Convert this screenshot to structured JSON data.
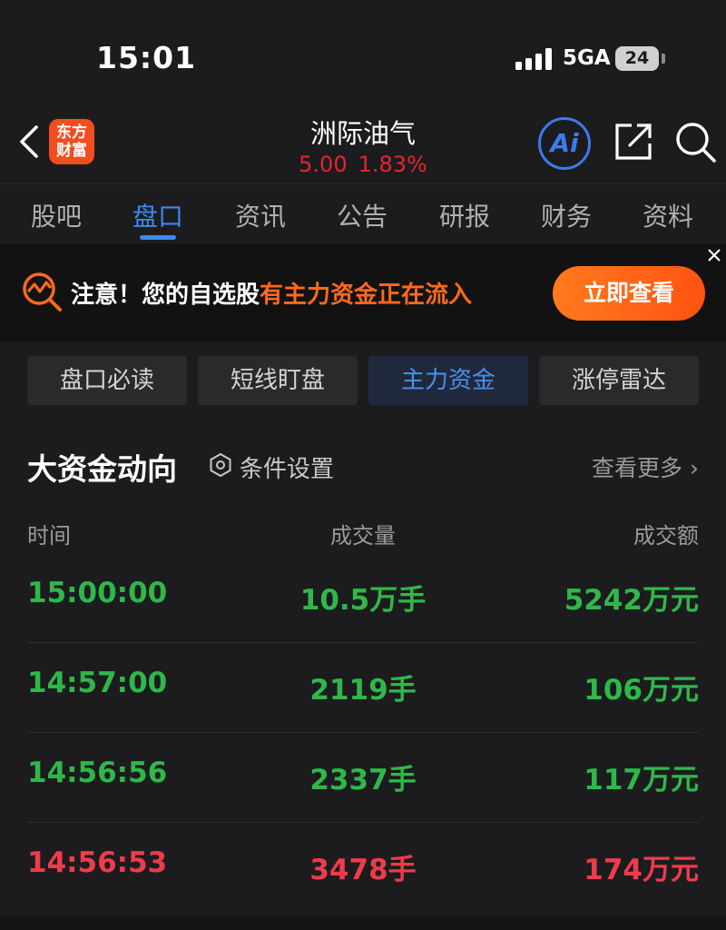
{
  "status_bar": {
    "time": "15:01",
    "network": "5GA",
    "battery": "24"
  },
  "header": {
    "logo_line1": "东方",
    "logo_line2": "财富",
    "stock_name": "洲际油气",
    "price": "5.00",
    "change_pct": "1.83%",
    "ai_label": "Ai",
    "icons": [
      "back-icon",
      "ai-icon",
      "share-icon",
      "search-icon"
    ]
  },
  "tabs": [
    {
      "label": "股吧"
    },
    {
      "label": "盘口",
      "active": true
    },
    {
      "label": "资讯"
    },
    {
      "label": "公告"
    },
    {
      "label": "研报"
    },
    {
      "label": "财务"
    },
    {
      "label": "资料"
    }
  ],
  "banner": {
    "prefix": "注意！您的自选股",
    "highlight": "有主力资金正在流入",
    "button": "立即查看"
  },
  "segments": [
    {
      "label": "盘口必读"
    },
    {
      "label": "短线盯盘"
    },
    {
      "label": "主力资金",
      "active": true
    },
    {
      "label": "涨停雷达"
    }
  ],
  "section": {
    "title": "大资金动向",
    "settings": "条件设置",
    "more": "查看更多 ›"
  },
  "table": {
    "headers": [
      "时间",
      "成交量",
      "成交额"
    ],
    "rows": [
      {
        "time": "15:00:00",
        "volume": "10.5万手",
        "amount": "5242万元",
        "color": "green"
      },
      {
        "time": "14:57:00",
        "volume": "2119手",
        "amount": "106万元",
        "color": "green"
      },
      {
        "time": "14:56:56",
        "volume": "2337手",
        "amount": "117万元",
        "color": "green"
      },
      {
        "time": "14:56:53",
        "volume": "3478手",
        "amount": "174万元",
        "color": "red"
      }
    ]
  },
  "colors": {
    "up": "#ef3b4b",
    "down": "#2fb84a",
    "accent": "#3d87f0",
    "banner_accent": "#ff6a1a"
  }
}
